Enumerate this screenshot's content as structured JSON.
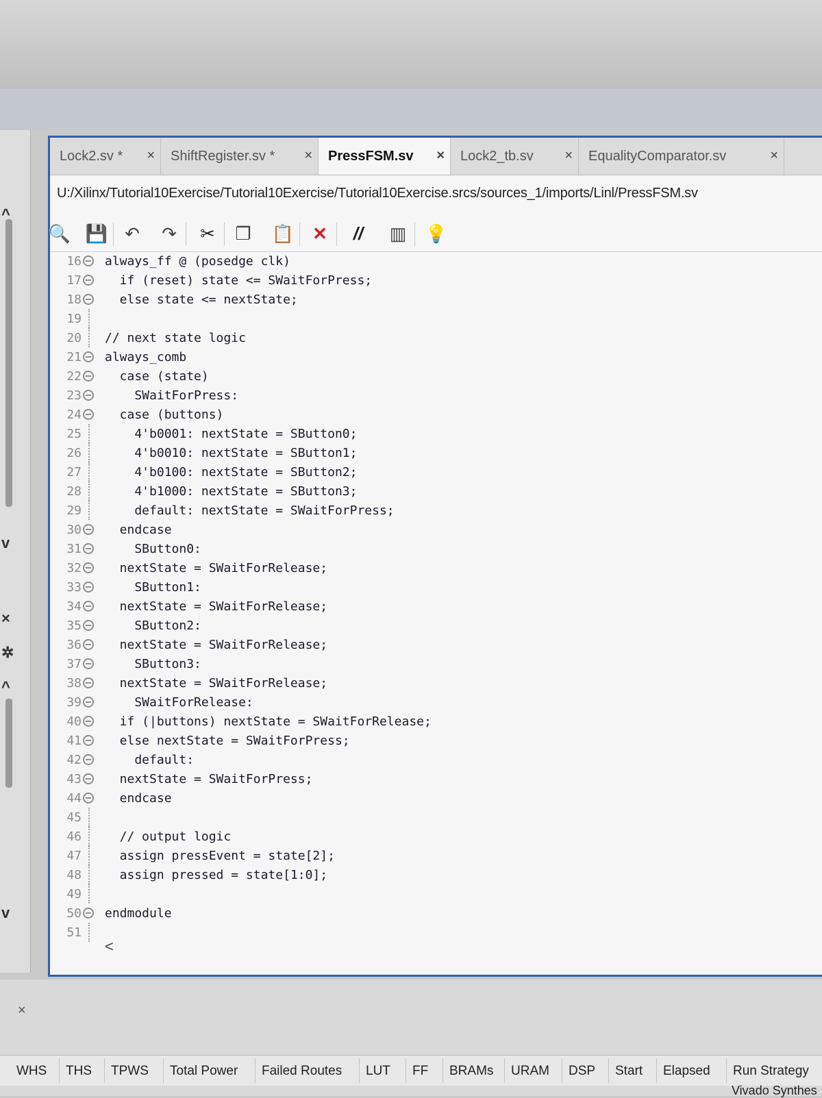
{
  "tabs": [
    {
      "label": "Lock2.sv *",
      "active": false
    },
    {
      "label": "ShiftRegister.sv *",
      "active": false
    },
    {
      "label": "PressFSM.sv",
      "active": true
    },
    {
      "label": "Lock2_tb.sv",
      "active": false
    },
    {
      "label": "EqualityComparator.sv",
      "active": false
    }
  ],
  "tab_close_glyph": "×",
  "file_path": "U:/Xilinx/Tutorial10Exercise/Tutorial10Exercise/Tutorial10Exercise.srcs/sources_1/imports/Linl/PressFSM.sv",
  "toolbar": [
    {
      "name": "search-icon",
      "glyph": "🔍"
    },
    {
      "name": "save-icon",
      "glyph": "💾"
    },
    {
      "name": "undo-icon",
      "glyph": "↶"
    },
    {
      "name": "redo-icon",
      "glyph": "↷"
    },
    {
      "name": "cut-icon",
      "glyph": "✂"
    },
    {
      "name": "copy-icon",
      "glyph": "❐"
    },
    {
      "name": "paste-icon",
      "glyph": "📋"
    },
    {
      "name": "delete-icon",
      "glyph": "✕"
    },
    {
      "name": "comment-icon",
      "glyph": "//"
    },
    {
      "name": "column-icon",
      "glyph": "▥"
    },
    {
      "name": "lightbulb-icon",
      "glyph": "💡"
    }
  ],
  "code_lines": [
    {
      "n": "16",
      "fold": "open",
      "text": "always_ff @ (posedge clk)"
    },
    {
      "n": "17",
      "fold": "open",
      "text": "  if (reset) state <= SWaitForPress;"
    },
    {
      "n": "18",
      "fold": "close",
      "text": "  else state <= nextState;"
    },
    {
      "n": "19",
      "fold": "none",
      "text": ""
    },
    {
      "n": "20",
      "fold": "none",
      "text": "// next state logic"
    },
    {
      "n": "21",
      "fold": "open",
      "text": "always_comb"
    },
    {
      "n": "22",
      "fold": "open",
      "text": "  case (state)"
    },
    {
      "n": "23",
      "fold": "open",
      "text": "    SWaitForPress:"
    },
    {
      "n": "24",
      "fold": "open",
      "text": "  case (buttons)"
    },
    {
      "n": "25",
      "fold": "none",
      "text": "    4'b0001: nextState = SButton0;"
    },
    {
      "n": "26",
      "fold": "none",
      "text": "    4'b0010: nextState = SButton1;"
    },
    {
      "n": "27",
      "fold": "none",
      "text": "    4'b0100: nextState = SButton2;"
    },
    {
      "n": "28",
      "fold": "none",
      "text": "    4'b1000: nextState = SButton3;"
    },
    {
      "n": "29",
      "fold": "none",
      "text": "    default: nextState = SWaitForPress;"
    },
    {
      "n": "30",
      "fold": "close",
      "text": "  endcase"
    },
    {
      "n": "31",
      "fold": "open",
      "text": "    SButton0:"
    },
    {
      "n": "32",
      "fold": "close",
      "text": "  nextState = SWaitForRelease;"
    },
    {
      "n": "33",
      "fold": "open",
      "text": "    SButton1:"
    },
    {
      "n": "34",
      "fold": "close",
      "text": "  nextState = SWaitForRelease;"
    },
    {
      "n": "35",
      "fold": "open",
      "text": "    SButton2:"
    },
    {
      "n": "36",
      "fold": "close",
      "text": "  nextState = SWaitForRelease;"
    },
    {
      "n": "37",
      "fold": "open",
      "text": "    SButton3:"
    },
    {
      "n": "38",
      "fold": "close",
      "text": "  nextState = SWaitForRelease;"
    },
    {
      "n": "39",
      "fold": "open",
      "text": "    SWaitForRelease:"
    },
    {
      "n": "40",
      "fold": "open",
      "text": "  if (|buttons) nextState = SWaitForRelease;"
    },
    {
      "n": "41",
      "fold": "close",
      "text": "  else nextState = SWaitForPress;"
    },
    {
      "n": "42",
      "fold": "open",
      "text": "    default:"
    },
    {
      "n": "43",
      "fold": "close",
      "text": "  nextState = SWaitForPress;"
    },
    {
      "n": "44",
      "fold": "close",
      "text": "  endcase"
    },
    {
      "n": "45",
      "fold": "none",
      "text": ""
    },
    {
      "n": "46",
      "fold": "none",
      "text": "  // output logic"
    },
    {
      "n": "47",
      "fold": "none",
      "text": "  assign pressEvent = state[2];"
    },
    {
      "n": "48",
      "fold": "none",
      "text": "  assign pressed = state[1:0];"
    },
    {
      "n": "49",
      "fold": "none",
      "text": ""
    },
    {
      "n": "50",
      "fold": "close",
      "text": "endmodule"
    },
    {
      "n": "51",
      "fold": "none",
      "text": ""
    }
  ],
  "scroll_left_glyph": "<",
  "panel_close_glyph": "×",
  "results_columns": [
    "WHS",
    "THS",
    "TPWS",
    "Total Power",
    "Failed Routes",
    "LUT",
    "FF",
    "BRAMs",
    "URAM",
    "DSP",
    "Start",
    "Elapsed",
    "Run Strategy"
  ],
  "run_strategy_value": "Vivado Synthes"
}
